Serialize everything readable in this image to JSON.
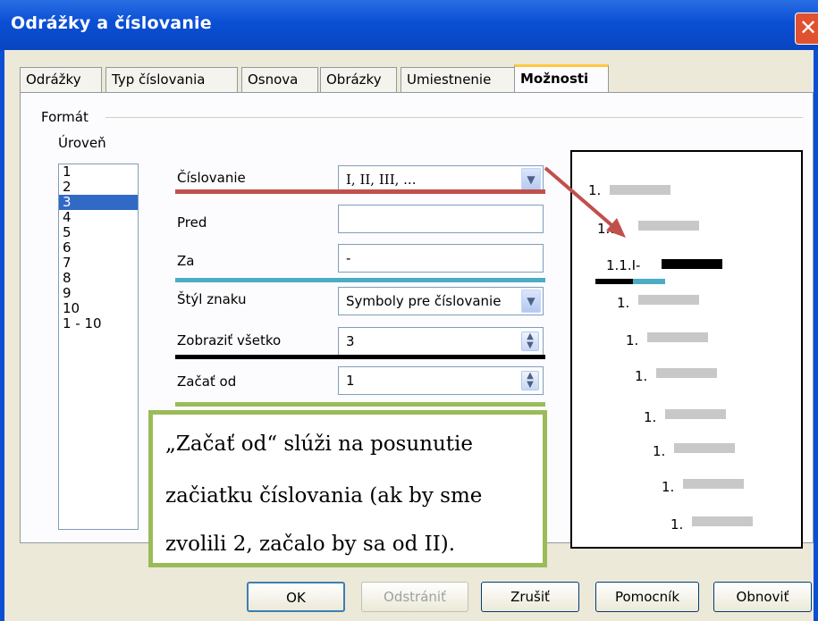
{
  "window": {
    "title": "Odrážky a číslovanie"
  },
  "tabs": [
    {
      "label": "Odrážky"
    },
    {
      "label": "Typ číslovania"
    },
    {
      "label": "Osnova"
    },
    {
      "label": "Obrázky"
    },
    {
      "label": "Umiestnenie"
    },
    {
      "label": "Možnosti",
      "active": true
    }
  ],
  "format": {
    "title": "Formát",
    "level_label": "Úroveň",
    "levels": [
      "1",
      "2",
      "3",
      "4",
      "5",
      "6",
      "7",
      "8",
      "9",
      "10",
      "1 - 10"
    ],
    "selected_level": "3"
  },
  "fields": {
    "numbering_label": "Číslovanie",
    "numbering_value": "I, II, III, ...",
    "before_label": "Pred",
    "before_value": "",
    "after_label": "Za",
    "after_value": "-",
    "char_style_label": "Štýl znaku",
    "char_style_value": "Symboly pre číslovanie",
    "show_all_label": "Zobraziť všetko",
    "show_all_value": "3",
    "start_label": "Začať od",
    "start_value": "1"
  },
  "preview": {
    "lines": [
      "1.",
      "1.1.",
      "1.1.I-",
      "1.",
      "1.",
      "1.",
      "1.",
      "1.",
      "1.",
      "1."
    ]
  },
  "annotation": {
    "lines": [
      "„Začať od“ slúži na posunutie",
      "začiatku číslovania (ak by sme",
      "zvolili 2, začalo by sa od II)."
    ]
  },
  "buttons": {
    "ok": "OK",
    "remove": "Odstrániť",
    "cancel": "Zrušiť",
    "help": "Pomocník",
    "reset": "Obnoviť"
  },
  "colors": {
    "underline_numbering": "#c0504d",
    "underline_after": "#4bacc6",
    "underline_show_all": "#000000",
    "underline_start": "#9bbb59",
    "arrow": "#c0504d",
    "note_border": "#9bbb59"
  }
}
